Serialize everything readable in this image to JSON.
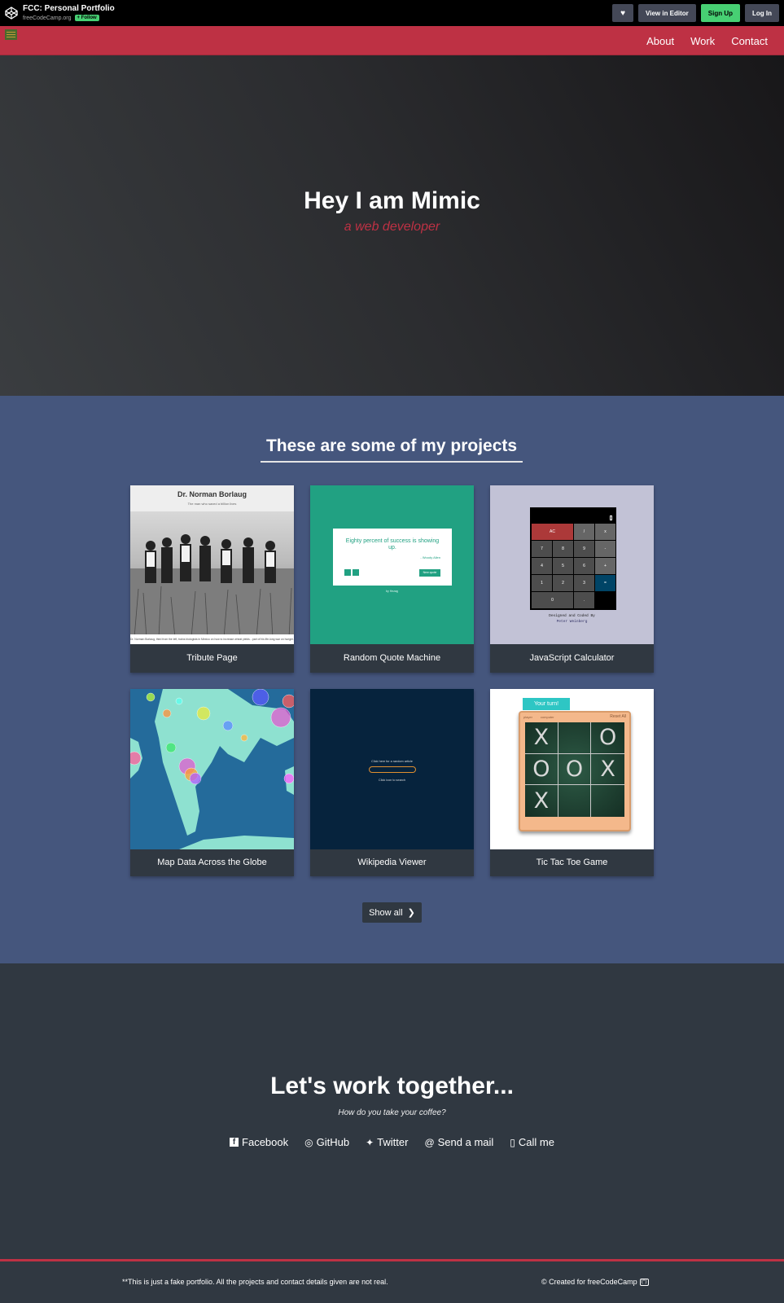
{
  "codepen": {
    "title": "FCC: Personal Portfolio",
    "author": "freeCodeCamp.org",
    "follow_label": "+ Follow",
    "heart_label": "♥",
    "view_editor_label": "View in Editor",
    "signup_label": "Sign Up",
    "login_label": "Log In"
  },
  "nav": {
    "links": [
      "About",
      "Work",
      "Contact"
    ]
  },
  "hero": {
    "title": "Hey I am Mimic",
    "tagline": "a web developer"
  },
  "projects": {
    "heading": "These are some of my projects",
    "items": [
      {
        "title": "Tribute Page"
      },
      {
        "title": "Random Quote Machine"
      },
      {
        "title": "JavaScript Calculator"
      },
      {
        "title": "Map Data Across the Globe"
      },
      {
        "title": "Wikipedia Viewer"
      },
      {
        "title": "Tic Tac Toe Game"
      }
    ],
    "show_all_label": "Show all",
    "thumbs": {
      "tribute_heading": "Dr. Norman Borlaug",
      "tribute_sub": "The man who saved a billion lives",
      "tribute_caption": "Dr. Norman Borlaug, third from the left, trains biologists in Mexico on how to increase wheat yields - part of his life-long war on hunger.",
      "quote_text": "Eighty percent of success is showing up.",
      "quote_author": "- Woody Allen",
      "quote_new": "New quote",
      "quote_by": "by Hezag",
      "calc_keys": [
        "AC",
        "/",
        "x",
        "7",
        "8",
        "9",
        "-",
        "4",
        "5",
        "6",
        "+",
        "1",
        "2",
        "3",
        "=",
        "0",
        "."
      ],
      "calc_credit": "Designed and Coded By",
      "calc_credit2": "Peter Weinberg",
      "wiki_top": "Click here for a random article",
      "wiki_bottom": "Click icon to search",
      "ttt_turn": "Your turn!",
      "ttt_player": "player",
      "ttt_computer": "computer",
      "ttt_reset": "Reset All",
      "ttt_board": [
        "X",
        "",
        "O",
        "O",
        "O",
        "X",
        "X",
        "",
        ""
      ]
    }
  },
  "contact": {
    "heading": "Let's work together...",
    "sub": "How do you take your coffee?",
    "links": [
      {
        "icon": "f",
        "label": "Facebook"
      },
      {
        "icon": "◎",
        "label": "GitHub"
      },
      {
        "icon": "🐦",
        "label": "Twitter"
      },
      {
        "icon": "@",
        "label": "Send a mail"
      },
      {
        "icon": "▯",
        "label": "Call me"
      }
    ]
  },
  "footer": {
    "left": "**This is just a fake portfolio. All the projects and contact details given are not real.",
    "right": "© Created for freeCodeCamp",
    "fcc_icon": "(^)"
  }
}
